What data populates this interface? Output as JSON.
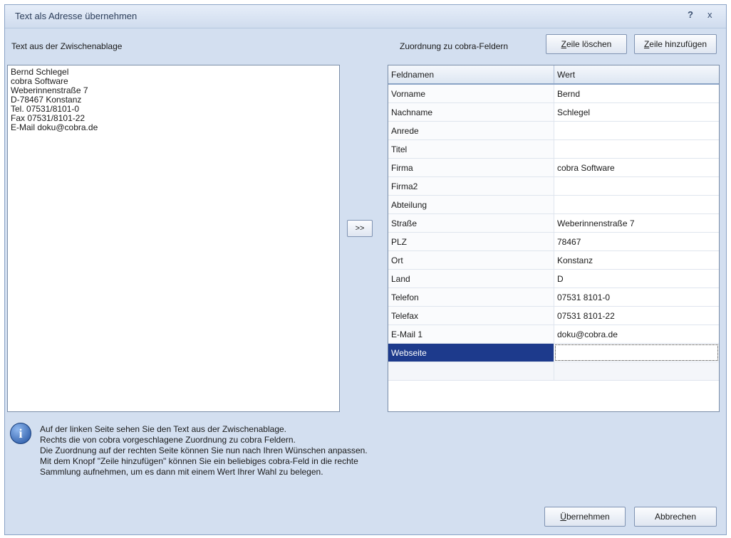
{
  "window": {
    "title": "Text als Adresse übernehmen",
    "help_label": "?",
    "close_label": "x"
  },
  "left": {
    "label": "Text aus der Zwischenablage",
    "clipboard_lines": [
      "Bernd Schlegel",
      "cobra Software",
      "Weberinnenstraße 7",
      "D-78467 Konstanz",
      "Tel. 07531/8101-0",
      "Fax 07531/8101-22",
      "E-Mail doku@cobra.de"
    ]
  },
  "transfer_button": ">>",
  "right": {
    "label": "Zuordnung zu cobra-Feldern",
    "delete_row_button": {
      "prefix": "",
      "mnemonic": "Z",
      "rest": "eile löschen"
    },
    "add_row_button": {
      "prefix": "",
      "mnemonic": "Z",
      "rest": "eile hinzufügen"
    },
    "grid": {
      "headers": [
        "Feldnamen",
        "Wert"
      ],
      "rows": [
        {
          "field": "Vorname",
          "value": "Bernd"
        },
        {
          "field": "Nachname",
          "value": "Schlegel"
        },
        {
          "field": "Anrede",
          "value": ""
        },
        {
          "field": "Titel",
          "value": ""
        },
        {
          "field": "Firma",
          "value": "cobra Software"
        },
        {
          "field": "Firma2",
          "value": ""
        },
        {
          "field": "Abteilung",
          "value": ""
        },
        {
          "field": "Straße",
          "value": "Weberinnenstraße 7"
        },
        {
          "field": "PLZ",
          "value": "78467"
        },
        {
          "field": "Ort",
          "value": "Konstanz"
        },
        {
          "field": "Land",
          "value": "D"
        },
        {
          "field": "Telefon",
          "value": "07531 8101-0"
        },
        {
          "field": "Telefax",
          "value": "07531 8101-22"
        },
        {
          "field": "E-Mail 1",
          "value": "doku@cobra.de"
        },
        {
          "field": "Webseite",
          "value": ""
        }
      ],
      "selected_index": 14
    }
  },
  "info": {
    "icon": "info-icon",
    "lines": [
      "Auf der linken Seite sehen Sie den Text aus der Zwischenablage.",
      "Rechts die von cobra vorgeschlagene Zuordnung zu cobra Feldern.",
      "Die Zuordnung auf der rechten Seite können Sie nun nach Ihren Wünschen anpassen.",
      "Mit dem Knopf \"Zeile hinzufügen\" können Sie ein beliebiges cobra-Feld in die rechte",
      "Sammlung aufnehmen, um es dann mit einem Wert Ihrer Wahl zu belegen."
    ]
  },
  "footer": {
    "ok_button": {
      "prefix": "",
      "mnemonic": "Ü",
      "rest": "bernehmen"
    },
    "cancel_button": "Abbrechen"
  }
}
